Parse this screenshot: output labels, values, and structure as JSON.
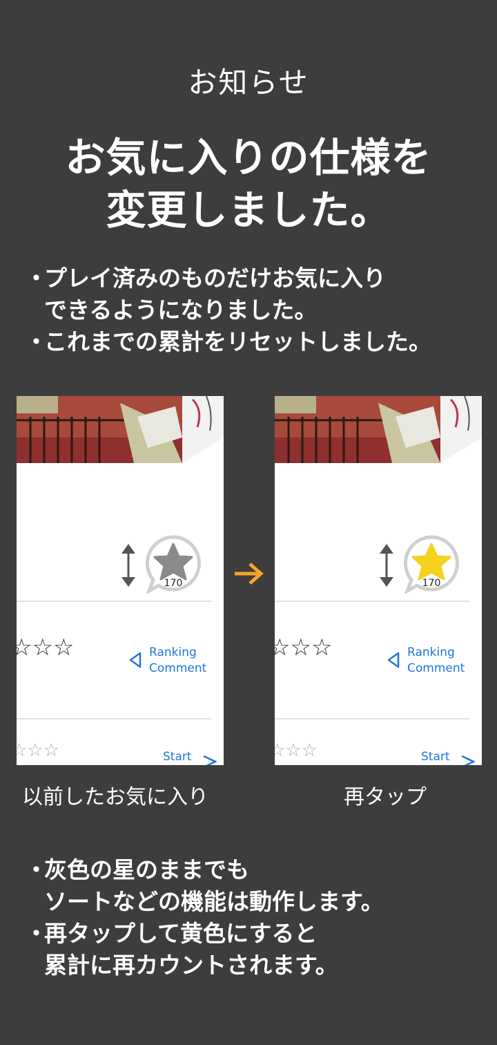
{
  "header": {
    "label": "お知らせ"
  },
  "headline": {
    "line1": "お気に入りの仕様を",
    "line2": "変更しました。"
  },
  "bullets_top": [
    {
      "dot": "・",
      "lines": [
        "プレイ済みのものだけお気に入り",
        "できるようになりました。"
      ]
    },
    {
      "dot": "・",
      "lines": [
        "これまでの累計をリセットしました。"
      ]
    }
  ],
  "before_panel": {
    "favorite_count": "170",
    "star_color": "#8a8a8a",
    "stars_row": "☆☆☆",
    "stars_row2": "☆☆☆",
    "link_lines": [
      "Ranking",
      "Comment"
    ],
    "start_label": "Start",
    "caption": "以前したお気に入り"
  },
  "after_panel": {
    "favorite_count": "170",
    "star_color": "#f5d21e",
    "stars_row": "☆☆☆",
    "stars_row2": "☆☆☆",
    "link_lines": [
      "Ranking",
      "Comment"
    ],
    "start_label": "Start",
    "caption": "再タップ"
  },
  "arrow_color": "#f5a623",
  "link_color": "#1f74e0",
  "bullets_bottom": [
    {
      "dot": "・",
      "lines": [
        "灰色の星のままでも",
        "ソートなどの機能は動作します。"
      ]
    },
    {
      "dot": "・",
      "lines": [
        "再タップして黄色にすると",
        "累計に再カウントされます。"
      ]
    }
  ]
}
